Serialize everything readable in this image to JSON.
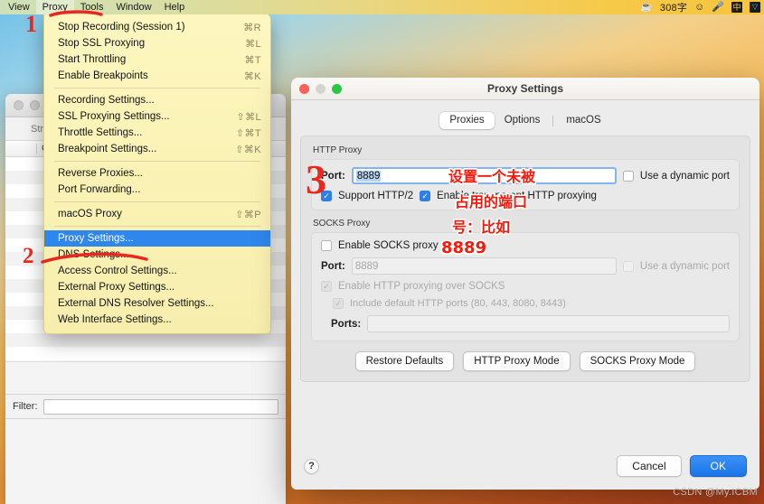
{
  "menubar": {
    "items": [
      {
        "label": "View",
        "active": false
      },
      {
        "label": "Proxy",
        "active": true
      },
      {
        "label": "Tools",
        "active": false
      },
      {
        "label": "Window",
        "active": false
      },
      {
        "label": "Help",
        "active": false
      }
    ],
    "status": {
      "coffee_icon": "coffee-cup-icon",
      "word_count": "308字",
      "emoji_icon": "smiley-face-icon",
      "mic_icon": "microphone-icon",
      "ime_label": "中",
      "ime2_label": "▽"
    }
  },
  "dropdown": {
    "groups": [
      [
        {
          "label": "Stop Recording (Session 1)",
          "shortcut": "⌘R",
          "selected": false
        },
        {
          "label": "Stop SSL Proxying",
          "shortcut": "⌘L",
          "selected": false
        },
        {
          "label": "Start Throttling",
          "shortcut": "⌘T",
          "selected": false
        },
        {
          "label": "Enable Breakpoints",
          "shortcut": "⌘K",
          "selected": false
        }
      ],
      [
        {
          "label": "Recording Settings...",
          "shortcut": "",
          "selected": false
        },
        {
          "label": "SSL Proxying Settings...",
          "shortcut": "⇧⌘L",
          "selected": false
        },
        {
          "label": "Throttle Settings...",
          "shortcut": "⇧⌘T",
          "selected": false
        },
        {
          "label": "Breakpoint Settings...",
          "shortcut": "⇧⌘K",
          "selected": false
        }
      ],
      [
        {
          "label": "Reverse Proxies...",
          "shortcut": "",
          "selected": false
        },
        {
          "label": "Port Forwarding...",
          "shortcut": "",
          "selected": false
        }
      ],
      [
        {
          "label": "macOS Proxy",
          "shortcut": "⇧⌘P",
          "selected": false
        }
      ],
      [
        {
          "label": "Proxy Settings...",
          "shortcut": "",
          "selected": true
        },
        {
          "label": "DNS Settings...",
          "shortcut": "",
          "selected": false
        },
        {
          "label": "Access Control Settings...",
          "shortcut": "",
          "selected": false
        },
        {
          "label": "External Proxy Settings...",
          "shortcut": "",
          "selected": false
        },
        {
          "label": "External DNS Resolver Settings...",
          "shortcut": "",
          "selected": false
        },
        {
          "label": "Web Interface Settings...",
          "shortcut": "",
          "selected": false
        }
      ]
    ]
  },
  "background_window": {
    "toolbar_label": "Structure",
    "column_header": "Code",
    "filter_label": "Filter:",
    "filter_value": "",
    "filter_placeholder": ""
  },
  "dialog": {
    "title": "Proxy Settings",
    "tabs": [
      {
        "label": "Proxies",
        "active": true
      },
      {
        "label": "Options",
        "active": false
      },
      {
        "label": "macOS",
        "active": false
      }
    ],
    "http_proxy": {
      "group_label": "HTTP Proxy",
      "port_label": "Port:",
      "port_value": "8889",
      "dynamic_port_label": "Use a dynamic port",
      "dynamic_port_checked": false,
      "support_http2_label": "Support HTTP/2",
      "support_http2_checked": true,
      "transparent_label": "Enable transparent HTTP proxying",
      "transparent_checked": true
    },
    "socks_proxy": {
      "group_label": "SOCKS Proxy",
      "enable_label": "Enable SOCKS proxy",
      "enable_checked": false,
      "port_label": "Port:",
      "port_value": "8889",
      "dynamic_port_label": "Use a dynamic port",
      "dynamic_port_checked": false,
      "http_over_socks_label": "Enable HTTP proxying over SOCKS",
      "http_over_socks_checked": true,
      "default_ports_label": "Include default HTTP ports (80, 443, 8080, 8443)",
      "default_ports_checked": true,
      "ports_label": "Ports:",
      "ports_value": ""
    },
    "mode_buttons": [
      {
        "label": "Restore Defaults"
      },
      {
        "label": "HTTP Proxy Mode"
      },
      {
        "label": "SOCKS Proxy Mode"
      }
    ],
    "help_label": "?",
    "cancel_label": "Cancel",
    "ok_label": "OK"
  },
  "annotations": {
    "step1": "1",
    "step2": "2",
    "step3": "3",
    "note_line1": "设置一个未被",
    "note_line2": "占用的端口",
    "note_line3": "号：比如",
    "note_line4": "8889",
    "color": "#e8281e"
  },
  "watermark": "CSDN @My.ICBM"
}
